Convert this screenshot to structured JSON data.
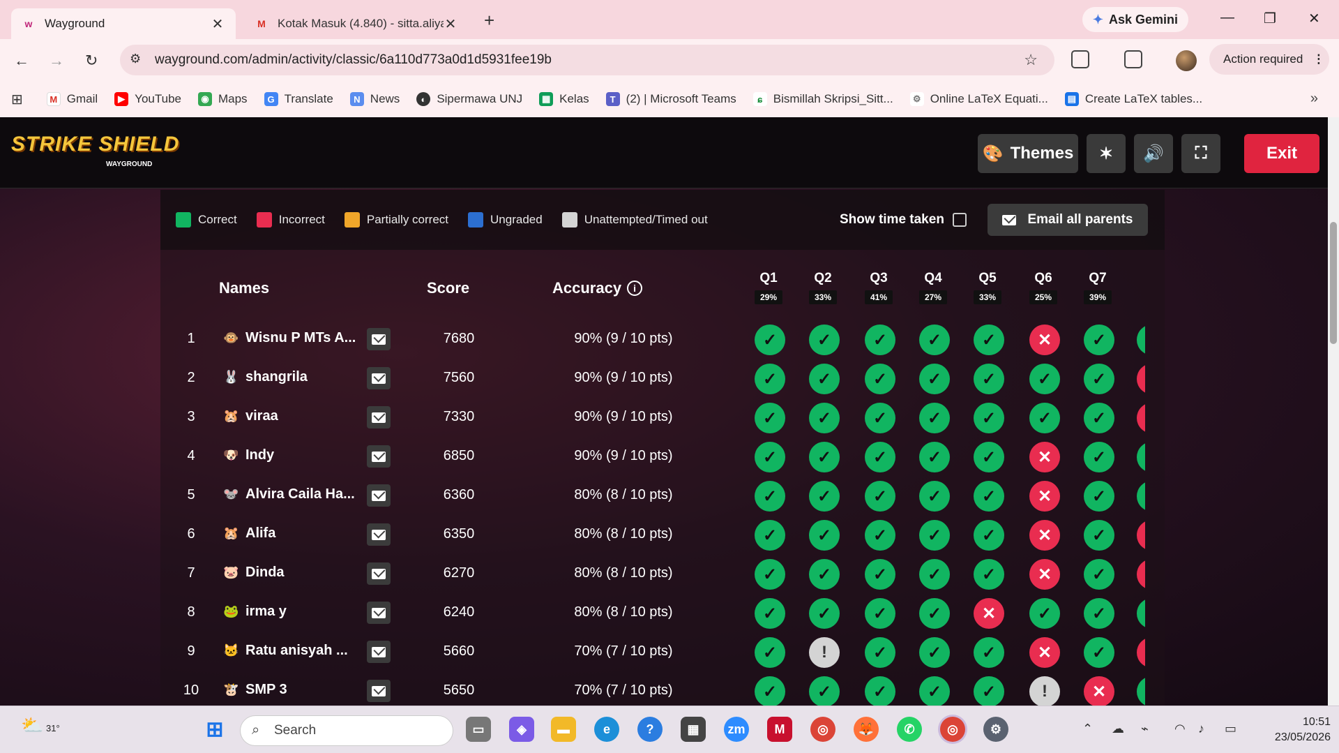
{
  "browser": {
    "tabs": [
      {
        "title": "Wayground",
        "active": true
      },
      {
        "title": "Kotak Masuk (4.840) - sitta.aliya",
        "active": false
      }
    ],
    "ask_gemini": "Ask Gemini",
    "url": "wayground.com/admin/activity/classic/6a110d773a0d1d5931fee19b",
    "action_required": "Action required",
    "bookmarks": [
      "Gmail",
      "YouTube",
      "Maps",
      "Translate",
      "News",
      "Sipermawa UNJ",
      "Kelas",
      "(2) | Microsoft Teams",
      "Bismillah Skripsi_Sitt...",
      "Online LaTeX Equati...",
      "Create LaTeX tables..."
    ]
  },
  "game": {
    "logo": "STRIKE SHIELD",
    "logo_sub": "WAYGROUND",
    "themes_label": "Themes",
    "exit_label": "Exit",
    "legend": [
      {
        "label": "Correct",
        "color": "#11b561"
      },
      {
        "label": "Incorrect",
        "color": "#e92d50"
      },
      {
        "label": "Partially correct",
        "color": "#f0a62a"
      },
      {
        "label": "Ungraded",
        "color": "#2c6fd1"
      },
      {
        "label": "Unattempted/Timed out",
        "color": "#d4d4d4"
      }
    ],
    "show_time_label": "Show time taken",
    "email_all_label": "Email all parents",
    "headers": {
      "names": "Names",
      "score": "Score",
      "accuracy": "Accuracy"
    },
    "questions": [
      {
        "q": "Q1",
        "pct": "29%"
      },
      {
        "q": "Q2",
        "pct": "33%"
      },
      {
        "q": "Q3",
        "pct": "41%"
      },
      {
        "q": "Q4",
        "pct": "27%"
      },
      {
        "q": "Q5",
        "pct": "33%"
      },
      {
        "q": "Q6",
        "pct": "25%"
      },
      {
        "q": "Q7",
        "pct": "39%"
      }
    ],
    "students": [
      {
        "rank": "1",
        "name": "Wisnu P MTs A...",
        "score": "7680",
        "accuracy": "90% (9 / 10 pts)",
        "results": [
          "c",
          "c",
          "c",
          "c",
          "c",
          "x",
          "c"
        ],
        "q8": "c"
      },
      {
        "rank": "2",
        "name": "shangrila",
        "score": "7560",
        "accuracy": "90% (9 / 10 pts)",
        "results": [
          "c",
          "c",
          "c",
          "c",
          "c",
          "c",
          "c"
        ],
        "q8": "x"
      },
      {
        "rank": "3",
        "name": "viraa",
        "score": "7330",
        "accuracy": "90% (9 / 10 pts)",
        "results": [
          "c",
          "c",
          "c",
          "c",
          "c",
          "c",
          "c"
        ],
        "q8": "x"
      },
      {
        "rank": "4",
        "name": "Indy",
        "score": "6850",
        "accuracy": "90% (9 / 10 pts)",
        "results": [
          "c",
          "c",
          "c",
          "c",
          "c",
          "x",
          "c"
        ],
        "q8": "c"
      },
      {
        "rank": "5",
        "name": "Alvira Caila Ha...",
        "score": "6360",
        "accuracy": "80% (8 / 10 pts)",
        "results": [
          "c",
          "c",
          "c",
          "c",
          "c",
          "x",
          "c"
        ],
        "q8": "c"
      },
      {
        "rank": "6",
        "name": "Alifa",
        "score": "6350",
        "accuracy": "80% (8 / 10 pts)",
        "results": [
          "c",
          "c",
          "c",
          "c",
          "c",
          "x",
          "c"
        ],
        "q8": "x"
      },
      {
        "rank": "7",
        "name": "Dinda",
        "score": "6270",
        "accuracy": "80% (8 / 10 pts)",
        "results": [
          "c",
          "c",
          "c",
          "c",
          "c",
          "x",
          "c"
        ],
        "q8": "x"
      },
      {
        "rank": "8",
        "name": "irma y",
        "score": "6240",
        "accuracy": "80% (8 / 10 pts)",
        "results": [
          "c",
          "c",
          "c",
          "c",
          "x",
          "c",
          "c"
        ],
        "q8": "c"
      },
      {
        "rank": "9",
        "name": "Ratu anisyah ...",
        "score": "5660",
        "accuracy": "70% (7 / 10 pts)",
        "results": [
          "c",
          "u",
          "c",
          "c",
          "c",
          "x",
          "c"
        ],
        "q8": "x"
      },
      {
        "rank": "10",
        "name": "SMP 3",
        "score": "5650",
        "accuracy": "70% (7 / 10 pts)",
        "results": [
          "c",
          "c",
          "c",
          "c",
          "c",
          "u",
          "x"
        ],
        "q8": "c"
      }
    ]
  },
  "taskbar": {
    "weather": "31°",
    "search_placeholder": "Search",
    "time": "10:51",
    "date": "23/05/2026"
  }
}
